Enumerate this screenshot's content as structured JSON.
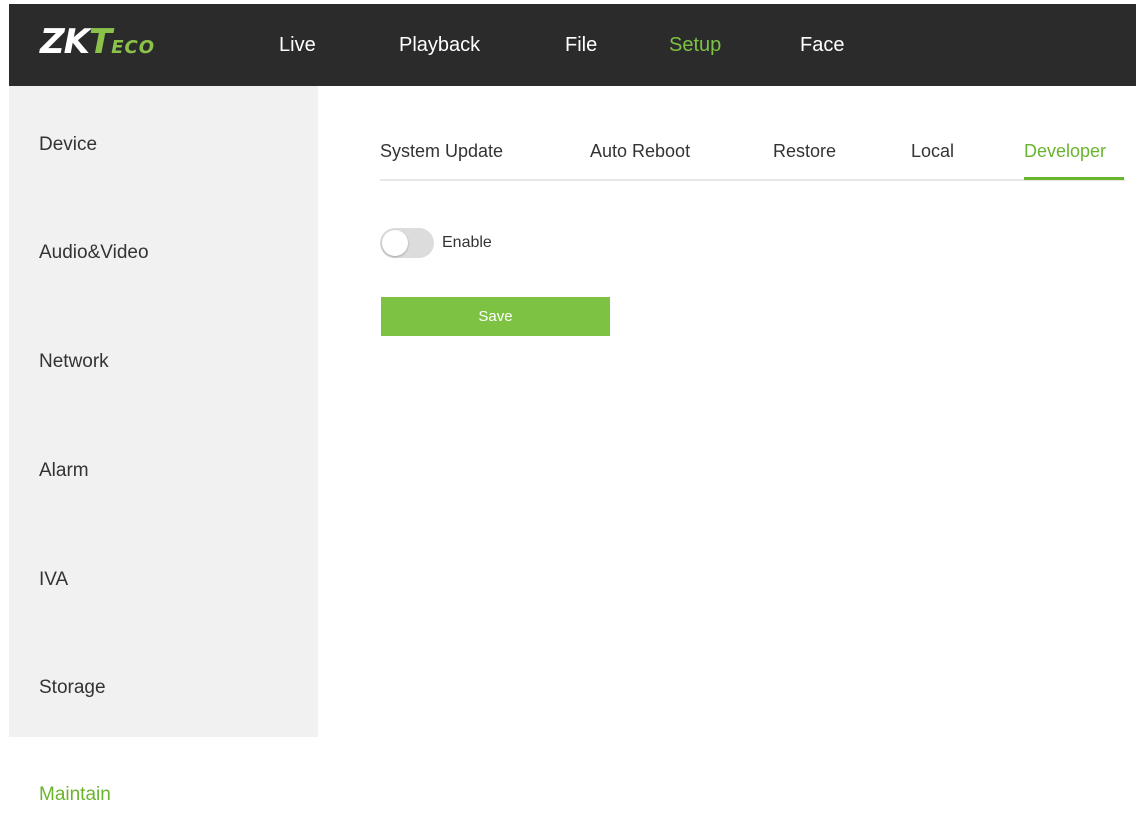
{
  "brand": {
    "logo_zk": "ZK",
    "logo_t": "T",
    "logo_eco": "ECO"
  },
  "topnav": {
    "items": [
      {
        "label": "Live"
      },
      {
        "label": "Playback"
      },
      {
        "label": "File"
      },
      {
        "label": "Setup",
        "active": true
      },
      {
        "label": "Face"
      }
    ]
  },
  "sidebar": {
    "items": [
      {
        "label": "Device"
      },
      {
        "label": "Audio&Video"
      },
      {
        "label": "Network"
      },
      {
        "label": "Alarm"
      },
      {
        "label": "IVA"
      },
      {
        "label": "Storage"
      },
      {
        "label": "Maintain",
        "active": true
      }
    ]
  },
  "tabs": {
    "items": [
      {
        "label": "System Update"
      },
      {
        "label": "Auto Reboot"
      },
      {
        "label": "Restore"
      },
      {
        "label": "Local"
      },
      {
        "label": "Developer",
        "active": true
      }
    ]
  },
  "developer": {
    "enable_label": "Enable",
    "enable_on": false,
    "save_label": "Save"
  },
  "colors": {
    "accent": "#7dc242",
    "topbar": "#2b2b2b",
    "sidebar": "#f1f1f1"
  }
}
